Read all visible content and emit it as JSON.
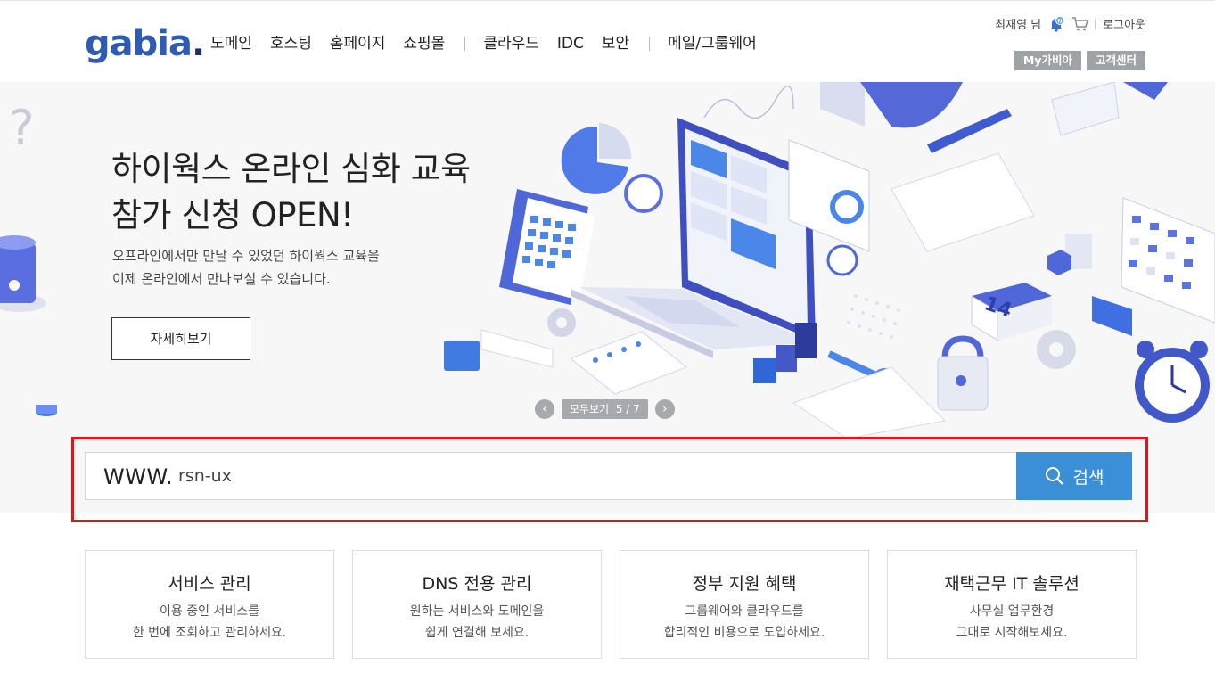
{
  "header": {
    "logo": "gabia",
    "logo_dot": ".",
    "nav_group1": [
      "도메인",
      "호스팅",
      "홈페이지",
      "쇼핑몰"
    ],
    "nav_group2": [
      "클라우드",
      "IDC",
      "보안"
    ],
    "nav_group3": [
      "메일/그룹웨어"
    ],
    "user": "최재영 님",
    "notification_badge": "N",
    "logout": "로그아웃",
    "mygabia": "My가비아",
    "support": "고객센터"
  },
  "banner": {
    "title_line1": "하이웍스 온라인 심화 교육",
    "title_line2": "참가 신청 OPEN!",
    "desc_line1": "오프라인에서만 만날 수 있었던 하이웍스 교육을",
    "desc_line2": "이제 온라인에서 만나보실 수 있습니다.",
    "cta": "자세히보기",
    "pager_label": "모두보기",
    "pager_count": "5 / 7",
    "calendar_day": "14"
  },
  "search": {
    "prefix": "WWW.",
    "value": "rsn-ux",
    "button": "검색"
  },
  "cards": [
    {
      "title": "서비스 관리",
      "line1": "이용 중인 서비스를",
      "line2": "한 번에 조회하고 관리하세요."
    },
    {
      "title": "DNS 전용 관리",
      "line1": "원하는 서비스와 도메인을",
      "line2": "쉽게 연결해 보세요."
    },
    {
      "title": "정부 지원 혜택",
      "line1": "그룹웨어와 클라우드를",
      "line2": "합리적인 비용으로 도입하세요."
    },
    {
      "title": "재택근무 IT 솔루션",
      "line1": "사무실 업무환경",
      "line2": "그대로 시작해보세요."
    }
  ],
  "colors": {
    "brand": "#2f5bb5",
    "search_button": "#3a8fd6",
    "highlight": "#e3151a",
    "util_button": "#9ea3a8"
  }
}
